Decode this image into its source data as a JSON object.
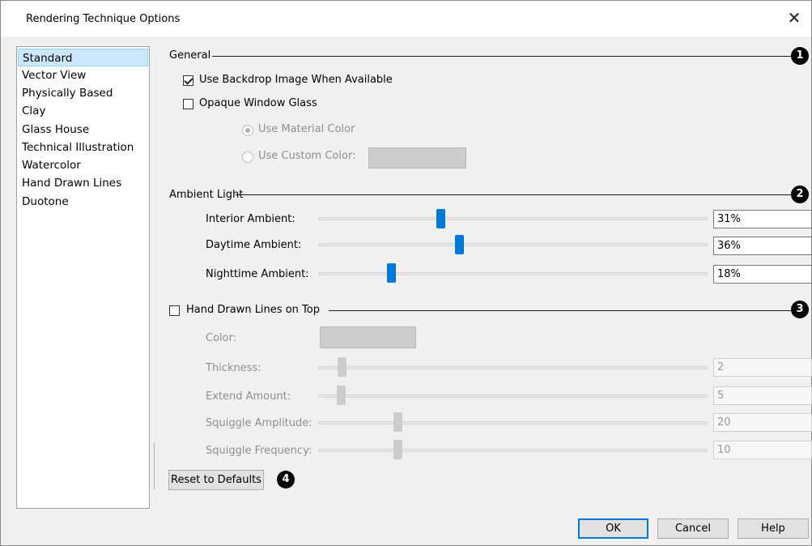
{
  "window": {
    "title": "Rendering Technique Options",
    "close_glyph": "✕"
  },
  "techniques": [
    "Standard",
    "Vector View",
    "Physically Based",
    "Clay",
    "Glass House",
    "Technical Illustration",
    "Watercolor",
    "Hand Drawn Lines",
    "Duotone"
  ],
  "selected_technique": "Standard",
  "general": {
    "label": "General",
    "badge": "1",
    "use_backdrop": {
      "label": "Use Backdrop Image When Available",
      "checked": true
    },
    "opaque_glass": {
      "label": "Opaque Window Glass",
      "checked": false
    },
    "use_material_color": {
      "label": "Use Material Color",
      "selected": true,
      "enabled": false
    },
    "use_custom_color": {
      "label": "Use Custom Color:",
      "selected": false,
      "enabled": false,
      "color": "#cccccc"
    }
  },
  "ambient": {
    "label": "Ambient Light",
    "badge": "2",
    "interior": {
      "label": "Interior Ambient:",
      "value": "31%",
      "level": 31
    },
    "daytime": {
      "label": "Daytime Ambient:",
      "value": "36%",
      "level": 36
    },
    "nighttime": {
      "label": "Nighttime Ambient:",
      "value": "18%",
      "level": 18
    }
  },
  "hand_drawn": {
    "label": "Hand Drawn Lines on Top",
    "badge": "3",
    "checked": false,
    "color": {
      "label": "Color:",
      "swatch": "#cccccc"
    },
    "thickness": {
      "label": "Thickness:",
      "value": "2"
    },
    "extend_amount": {
      "label": "Extend Amount:",
      "value": "5"
    },
    "squiggle_amplitude": {
      "label": "Squiggle Amplitude:",
      "value": "20"
    },
    "squiggle_frequency": {
      "label": "Squiggle Frequency:",
      "value": "10"
    }
  },
  "reset": {
    "label": "Reset to Defaults",
    "badge": "4"
  },
  "buttons": {
    "ok": "OK",
    "cancel": "Cancel",
    "help": "Help"
  },
  "colors": {
    "accent": "#0078d7",
    "selection": "#cce8ff",
    "disabled_text": "#8f8f8f"
  }
}
